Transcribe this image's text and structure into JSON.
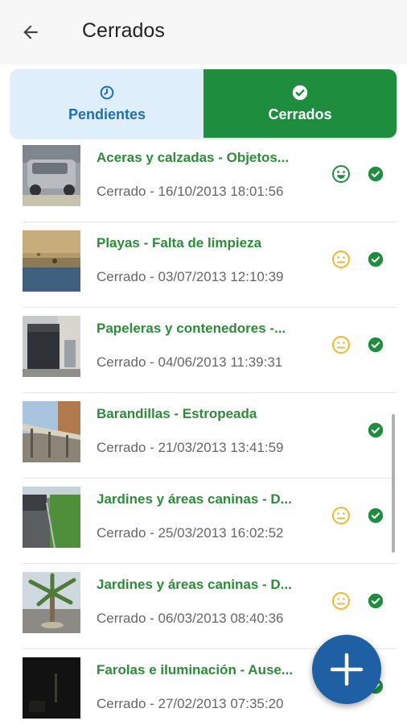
{
  "header": {
    "title": "Cerrados",
    "back_icon": "arrow-back-icon"
  },
  "tabs": [
    {
      "label": "Pendientes",
      "icon": "clock-icon",
      "selected": false
    },
    {
      "label": "Cerrados",
      "icon": "check-circle-icon",
      "selected": true
    }
  ],
  "colors": {
    "accent_green": "#1e8e3e",
    "title_green": "#2e8b3a",
    "pending_bg": "#dfeefb",
    "pending_text": "#1f6fb7",
    "fab_blue": "#1f5fa4",
    "face_yellow": "#f2b630"
  },
  "items": [
    {
      "title": "Aceras y calzadas - Objetos...",
      "subtitle": "Cerrado - 16/10/2013 18:01:56",
      "rating": "happy-face-icon",
      "status": "check-circle-icon"
    },
    {
      "title": "Playas - Falta de limpieza",
      "subtitle": "Cerrado - 03/07/2013 12:10:39",
      "rating": "neutral-face-icon",
      "status": "check-circle-icon"
    },
    {
      "title": "Papeleras y contenedores -...",
      "subtitle": "Cerrado - 04/06/2013 11:39:31",
      "rating": "neutral-face-icon",
      "status": "check-circle-icon"
    },
    {
      "title": "Barandillas - Estropeada",
      "subtitle": "Cerrado - 21/03/2013 13:41:59",
      "rating": "",
      "status": "check-circle-icon"
    },
    {
      "title": "Jardines y áreas caninas - D...",
      "subtitle": "Cerrado - 25/03/2013 16:02:52",
      "rating": "neutral-face-icon",
      "status": "check-circle-icon"
    },
    {
      "title": "Jardines y áreas caninas - D...",
      "subtitle": "Cerrado - 06/03/2013 08:40:36",
      "rating": "neutral-face-icon",
      "status": "check-circle-icon"
    },
    {
      "title": "Farolas e iluminación - Ause...",
      "subtitle": "Cerrado - 27/02/2013 07:35:20",
      "rating": "",
      "status": "check-circle-icon"
    }
  ],
  "fab": {
    "icon": "plus-icon"
  }
}
